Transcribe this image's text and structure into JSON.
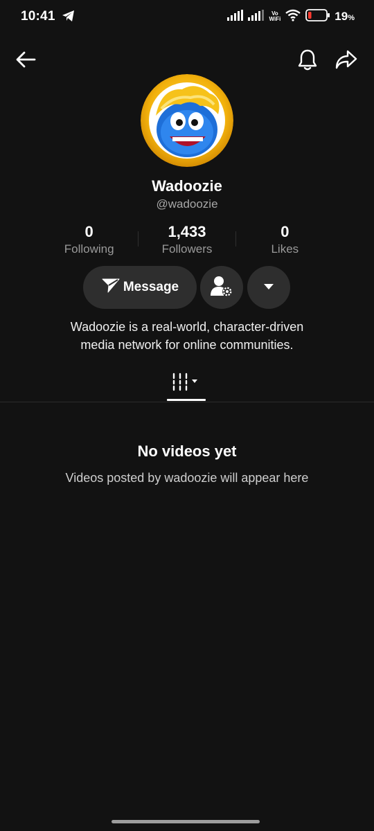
{
  "status_bar": {
    "time": "10:41",
    "volte_top": "Vo",
    "volte_bottom": "WiFi",
    "battery_percent": "19",
    "battery_suffix": "%",
    "battery_level": 0.19,
    "battery_color": "#ff3b30",
    "icons": [
      "telegram-icon",
      "signal-icon",
      "signal-icon",
      "wifi-icon",
      "battery-icon"
    ]
  },
  "top_bar": {
    "back_icon": "arrow-left-icon",
    "notification_icon": "bell-icon",
    "share_icon": "share-arrow-icon"
  },
  "profile": {
    "display_name": "Wadoozie",
    "handle": "@wadoozie",
    "bio_line1": "Wadoozie is a real-world, character-driven",
    "bio_line2": "media network for online communities."
  },
  "stats": [
    {
      "value": "0",
      "label": "Following"
    },
    {
      "value": "1,433",
      "label": "Followers"
    },
    {
      "value": "0",
      "label": "Likes"
    }
  ],
  "actions": {
    "message_label": "Message",
    "friend_settings_icon": "user-gear-icon",
    "more_icon": "triangle-down-icon"
  },
  "tabs": {
    "videos_icon": "grid-filter-icon"
  },
  "empty_state": {
    "title": "No videos yet",
    "subtitle": "Videos posted by wadoozie will appear here"
  },
  "colors": {
    "background": "#121212",
    "button_bg": "#2e2e2e",
    "muted_text": "#a7a7a7"
  }
}
